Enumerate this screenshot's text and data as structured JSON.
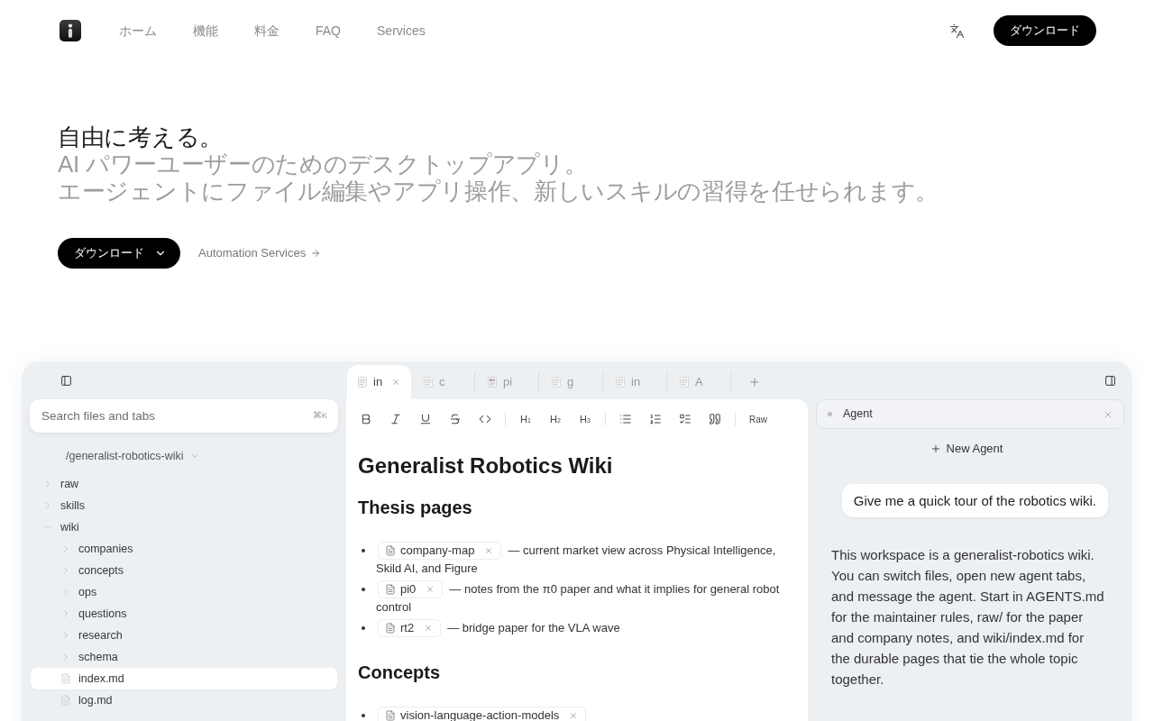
{
  "nav": {
    "links": [
      {
        "label": "ホーム"
      },
      {
        "label": "機能"
      },
      {
        "label": "料金"
      },
      {
        "label": "FAQ"
      },
      {
        "label": "Services"
      }
    ],
    "download_button": "ダウンロード"
  },
  "hero": {
    "title": "自由に考える。",
    "subtitle": [
      "AI パワーユーザーのためのデスクトップアプリ。",
      "エージェントにファイル編集やアプリ操作、新しいスキルの習得を任せられます。"
    ],
    "download_button": "ダウンロード",
    "services_link": "Automation Services"
  },
  "app": {
    "sidebar": {
      "search": {
        "placeholder": "Search files and tabs",
        "shortcut": "⌘K"
      },
      "workspace": "/generalist-robotics-wiki",
      "tree": [
        {
          "name": "raw",
          "kind": "folder",
          "expanded": false,
          "selected": false
        },
        {
          "name": "skills",
          "kind": "folder",
          "expanded": false,
          "selected": false
        },
        {
          "name": "wiki",
          "kind": "folder",
          "expanded": true,
          "selected": false,
          "children": [
            {
              "name": "companies",
              "kind": "folder",
              "expanded": false,
              "selected": false
            },
            {
              "name": "concepts",
              "kind": "folder",
              "expanded": false,
              "selected": false
            },
            {
              "name": "ops",
              "kind": "folder",
              "expanded": false,
              "selected": false
            },
            {
              "name": "questions",
              "kind": "folder",
              "expanded": false,
              "selected": false
            },
            {
              "name": "research",
              "kind": "folder",
              "expanded": false,
              "selected": false
            },
            {
              "name": "schema",
              "kind": "folder",
              "expanded": false,
              "selected": false
            },
            {
              "name": "index.md",
              "kind": "file",
              "selected": true
            },
            {
              "name": "log.md",
              "kind": "file",
              "selected": false
            }
          ]
        }
      ]
    },
    "tabs": [
      {
        "label": "in",
        "kind": "note",
        "selected": true
      },
      {
        "label": "c",
        "kind": "note",
        "selected": false
      },
      {
        "label": "pi",
        "kind": "pdf",
        "selected": false
      },
      {
        "label": "g",
        "kind": "note",
        "selected": false
      },
      {
        "label": "in",
        "kind": "note",
        "selected": false
      },
      {
        "label": "A",
        "kind": "note",
        "selected": false
      }
    ],
    "toolbar": {
      "headings": [
        "H$_{1}$",
        "H$_{2}$",
        "H$_{3}$"
      ],
      "raw_button": "Raw"
    },
    "document": {
      "title": "Generalist Robotics Wiki",
      "sections": [
        {
          "heading": "Thesis pages",
          "items": [
            {
              "link": "company-map",
              "text": "— current market view across Physical Intelligence, Skild AI, and Figure"
            },
            {
              "link": "pi0",
              "text": "— notes from the π0 paper and what it implies for general robot control"
            },
            {
              "link": "rt2",
              "text": "— bridge paper for the VLA wave"
            }
          ]
        },
        {
          "heading": "Concepts",
          "items": [
            {
              "link": "vision-language-action-models"
            }
          ]
        }
      ]
    },
    "agent": {
      "tabs": [
        {
          "label": "Agent",
          "selected": true
        }
      ],
      "new_agent_button": "New Agent",
      "messages": [
        {
          "kind": "user",
          "text": "Give me a quick tour of the robotics wiki."
        },
        {
          "kind": "assistant",
          "text": "This workspace is a generalist-robotics wiki. You can switch files, open new agent tabs, and message the agent. Start in AGENTS.md for the maintainer rules, raw/ for the paper and company notes, and wiki/index.md for the durable pages that tie the whole topic together."
        }
      ]
    }
  }
}
